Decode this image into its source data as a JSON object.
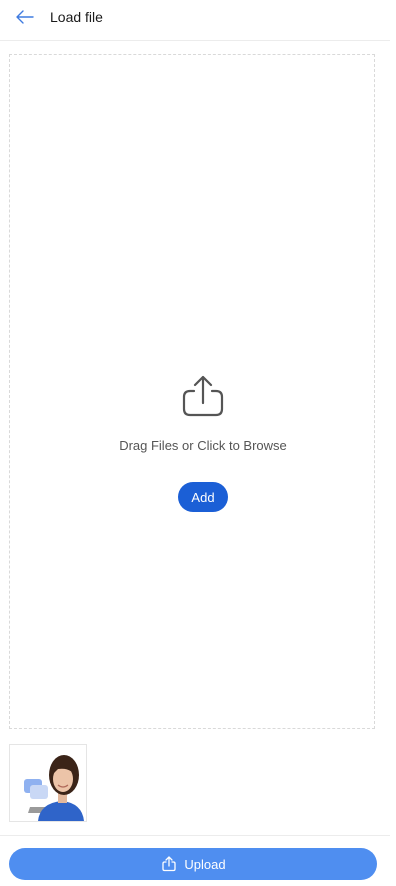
{
  "header": {
    "title": "Load file",
    "back_icon": "arrow-left-icon"
  },
  "dropzone": {
    "icon": "upload-share-icon",
    "hint": "Drag Files or Click to Browse",
    "add_label": "Add"
  },
  "attachments": [
    {
      "type": "image",
      "description_icon": "profile-photo-thumbnail"
    }
  ],
  "footer": {
    "upload_label": "Upload",
    "upload_icon": "upload-share-icon"
  },
  "colors": {
    "accent": "#1b5fd6",
    "upload_button": "#4f8ef0",
    "back_arrow": "#3f7be0",
    "border": "#d9d9d9"
  }
}
